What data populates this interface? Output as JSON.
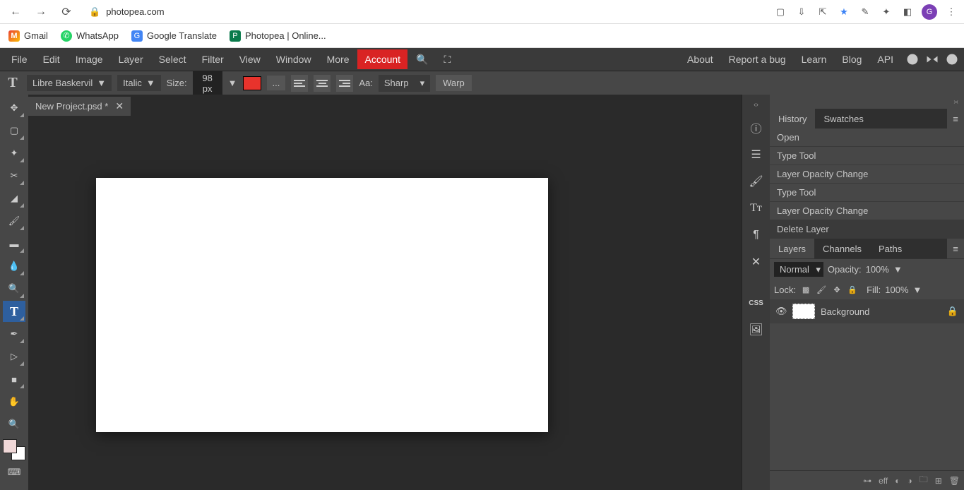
{
  "browser": {
    "url_host": "photopea.com",
    "avatar_letter": "G"
  },
  "bookmarks": [
    {
      "label": "Gmail"
    },
    {
      "label": "WhatsApp"
    },
    {
      "label": "Google Translate"
    },
    {
      "label": "Photopea | Online..."
    }
  ],
  "menu": {
    "items": [
      "File",
      "Edit",
      "Image",
      "Layer",
      "Select",
      "Filter",
      "View",
      "Window",
      "More"
    ],
    "account": "Account",
    "right": [
      "About",
      "Report a bug",
      "Learn",
      "Blog",
      "API"
    ]
  },
  "options": {
    "font": "Libre Baskervil",
    "style": "Italic",
    "size_label": "Size:",
    "size_value": "98 px",
    "aa_label": "Aa:",
    "aa_value": "Sharp",
    "warp": "Warp",
    "more": "..."
  },
  "tab": {
    "name": "New Project.psd *"
  },
  "panels": {
    "history_tab": "History",
    "swatches_tab": "Swatches",
    "history": [
      "Open",
      "Type Tool",
      "Layer Opacity Change",
      "Type Tool",
      "Layer Opacity Change",
      "Delete Layer"
    ],
    "layers_tab": "Layers",
    "channels_tab": "Channels",
    "paths_tab": "Paths",
    "blend_mode": "Normal",
    "opacity_label": "Opacity:",
    "opacity_value": "100%",
    "lock_label": "Lock:",
    "fill_label": "Fill:",
    "fill_value": "100%",
    "layer_name": "Background",
    "css_label": "CSS"
  },
  "footer_icons": {
    "link": "⊶",
    "fx": "eff"
  }
}
